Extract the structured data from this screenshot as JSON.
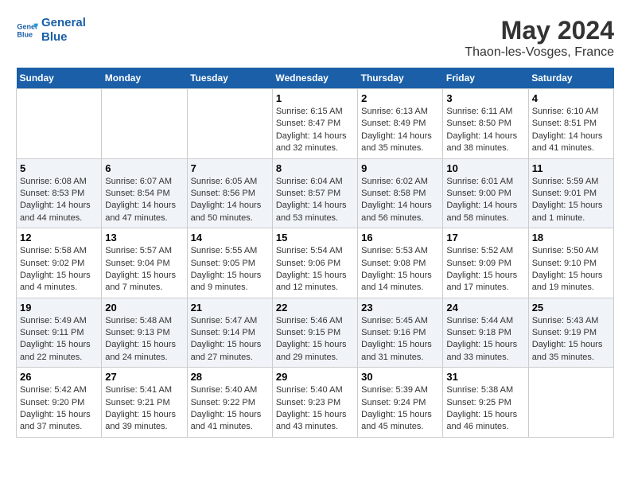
{
  "header": {
    "logo_line1": "General",
    "logo_line2": "Blue",
    "main_title": "May 2024",
    "sub_title": "Thaon-les-Vosges, France"
  },
  "days_of_week": [
    "Sunday",
    "Monday",
    "Tuesday",
    "Wednesday",
    "Thursday",
    "Friday",
    "Saturday"
  ],
  "weeks": [
    [
      {
        "num": "",
        "info": ""
      },
      {
        "num": "",
        "info": ""
      },
      {
        "num": "",
        "info": ""
      },
      {
        "num": "1",
        "info": "Sunrise: 6:15 AM\nSunset: 8:47 PM\nDaylight: 14 hours\nand 32 minutes."
      },
      {
        "num": "2",
        "info": "Sunrise: 6:13 AM\nSunset: 8:49 PM\nDaylight: 14 hours\nand 35 minutes."
      },
      {
        "num": "3",
        "info": "Sunrise: 6:11 AM\nSunset: 8:50 PM\nDaylight: 14 hours\nand 38 minutes."
      },
      {
        "num": "4",
        "info": "Sunrise: 6:10 AM\nSunset: 8:51 PM\nDaylight: 14 hours\nand 41 minutes."
      }
    ],
    [
      {
        "num": "5",
        "info": "Sunrise: 6:08 AM\nSunset: 8:53 PM\nDaylight: 14 hours\nand 44 minutes."
      },
      {
        "num": "6",
        "info": "Sunrise: 6:07 AM\nSunset: 8:54 PM\nDaylight: 14 hours\nand 47 minutes."
      },
      {
        "num": "7",
        "info": "Sunrise: 6:05 AM\nSunset: 8:56 PM\nDaylight: 14 hours\nand 50 minutes."
      },
      {
        "num": "8",
        "info": "Sunrise: 6:04 AM\nSunset: 8:57 PM\nDaylight: 14 hours\nand 53 minutes."
      },
      {
        "num": "9",
        "info": "Sunrise: 6:02 AM\nSunset: 8:58 PM\nDaylight: 14 hours\nand 56 minutes."
      },
      {
        "num": "10",
        "info": "Sunrise: 6:01 AM\nSunset: 9:00 PM\nDaylight: 14 hours\nand 58 minutes."
      },
      {
        "num": "11",
        "info": "Sunrise: 5:59 AM\nSunset: 9:01 PM\nDaylight: 15 hours\nand 1 minute."
      }
    ],
    [
      {
        "num": "12",
        "info": "Sunrise: 5:58 AM\nSunset: 9:02 PM\nDaylight: 15 hours\nand 4 minutes."
      },
      {
        "num": "13",
        "info": "Sunrise: 5:57 AM\nSunset: 9:04 PM\nDaylight: 15 hours\nand 7 minutes."
      },
      {
        "num": "14",
        "info": "Sunrise: 5:55 AM\nSunset: 9:05 PM\nDaylight: 15 hours\nand 9 minutes."
      },
      {
        "num": "15",
        "info": "Sunrise: 5:54 AM\nSunset: 9:06 PM\nDaylight: 15 hours\nand 12 minutes."
      },
      {
        "num": "16",
        "info": "Sunrise: 5:53 AM\nSunset: 9:08 PM\nDaylight: 15 hours\nand 14 minutes."
      },
      {
        "num": "17",
        "info": "Sunrise: 5:52 AM\nSunset: 9:09 PM\nDaylight: 15 hours\nand 17 minutes."
      },
      {
        "num": "18",
        "info": "Sunrise: 5:50 AM\nSunset: 9:10 PM\nDaylight: 15 hours\nand 19 minutes."
      }
    ],
    [
      {
        "num": "19",
        "info": "Sunrise: 5:49 AM\nSunset: 9:11 PM\nDaylight: 15 hours\nand 22 minutes."
      },
      {
        "num": "20",
        "info": "Sunrise: 5:48 AM\nSunset: 9:13 PM\nDaylight: 15 hours\nand 24 minutes."
      },
      {
        "num": "21",
        "info": "Sunrise: 5:47 AM\nSunset: 9:14 PM\nDaylight: 15 hours\nand 27 minutes."
      },
      {
        "num": "22",
        "info": "Sunrise: 5:46 AM\nSunset: 9:15 PM\nDaylight: 15 hours\nand 29 minutes."
      },
      {
        "num": "23",
        "info": "Sunrise: 5:45 AM\nSunset: 9:16 PM\nDaylight: 15 hours\nand 31 minutes."
      },
      {
        "num": "24",
        "info": "Sunrise: 5:44 AM\nSunset: 9:18 PM\nDaylight: 15 hours\nand 33 minutes."
      },
      {
        "num": "25",
        "info": "Sunrise: 5:43 AM\nSunset: 9:19 PM\nDaylight: 15 hours\nand 35 minutes."
      }
    ],
    [
      {
        "num": "26",
        "info": "Sunrise: 5:42 AM\nSunset: 9:20 PM\nDaylight: 15 hours\nand 37 minutes."
      },
      {
        "num": "27",
        "info": "Sunrise: 5:41 AM\nSunset: 9:21 PM\nDaylight: 15 hours\nand 39 minutes."
      },
      {
        "num": "28",
        "info": "Sunrise: 5:40 AM\nSunset: 9:22 PM\nDaylight: 15 hours\nand 41 minutes."
      },
      {
        "num": "29",
        "info": "Sunrise: 5:40 AM\nSunset: 9:23 PM\nDaylight: 15 hours\nand 43 minutes."
      },
      {
        "num": "30",
        "info": "Sunrise: 5:39 AM\nSunset: 9:24 PM\nDaylight: 15 hours\nand 45 minutes."
      },
      {
        "num": "31",
        "info": "Sunrise: 5:38 AM\nSunset: 9:25 PM\nDaylight: 15 hours\nand 46 minutes."
      },
      {
        "num": "",
        "info": ""
      }
    ]
  ]
}
